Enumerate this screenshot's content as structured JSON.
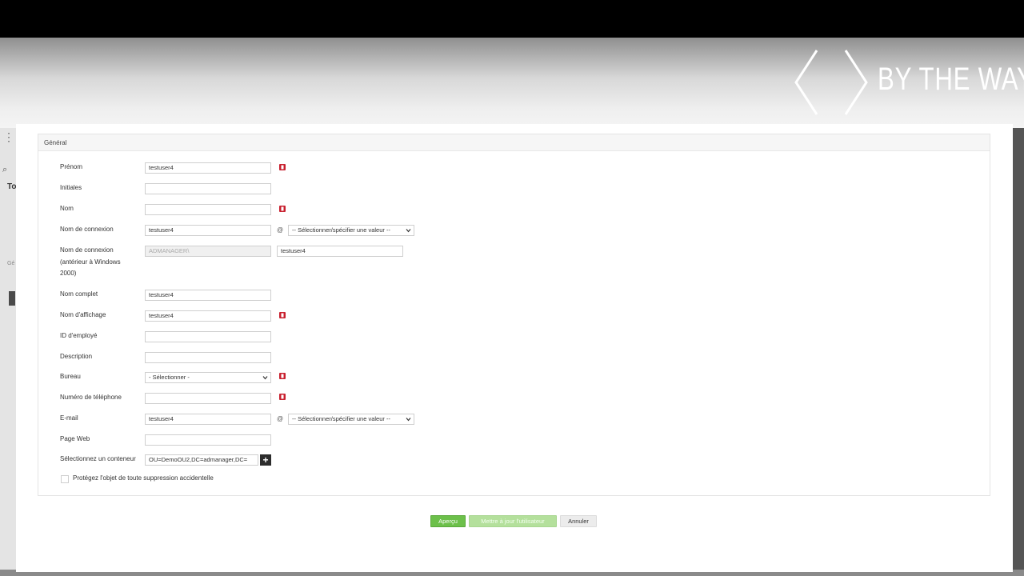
{
  "brand": {
    "text": "BY THE WAY"
  },
  "background_app": {
    "search_glyph": "⌕",
    "to_text": "To",
    "ge_text": "Gé"
  },
  "form": {
    "section_title": "Général",
    "fields": {
      "prenom": {
        "label": "Prénom",
        "value": "testuser4"
      },
      "initiales": {
        "label": "Initiales",
        "value": ""
      },
      "nom": {
        "label": "Nom",
        "value": ""
      },
      "nom_connexion": {
        "label": "Nom de connexion",
        "value": "testuser4",
        "at": "@",
        "domain_select": "-- Sélectionner/spécifier une valeur --"
      },
      "nom_connexion_pre2000": {
        "label_line1": "Nom de connexion",
        "label_line2": "(antérieur à Windows",
        "label_line3": "2000)",
        "prefix": "ADMANAGER\\",
        "value": "testuser4"
      },
      "nom_complet": {
        "label": "Nom complet",
        "value": "testuser4"
      },
      "nom_affichage": {
        "label": "Nom d'affichage",
        "value": "testuser4"
      },
      "id_employe": {
        "label": "ID d'employé",
        "value": ""
      },
      "description": {
        "label": "Description",
        "value": ""
      },
      "bureau": {
        "label": "Bureau",
        "select_value": "- Sélectionner -"
      },
      "telephone": {
        "label": "Numéro de téléphone",
        "value": ""
      },
      "email": {
        "label": "E-mail",
        "value": "testuser4",
        "at": "@",
        "domain_select": "-- Sélectionner/spécifier une valeur --"
      },
      "page_web": {
        "label": "Page Web",
        "value": ""
      },
      "conteneur": {
        "label": "Sélectionnez un conteneur",
        "value": "OU=DemoOU2,DC=admanager,DC="
      },
      "protect": {
        "label": "Protégez l'objet de toute suppression accidentelle",
        "checked": false
      }
    }
  },
  "buttons": {
    "preview": "Aperçu",
    "update": "Mettre à jour l'utilisateur",
    "cancel": "Annuler"
  },
  "colors": {
    "office_icon": "#c8202f",
    "primary_button": "#6cc04a",
    "disabled_button": "#b4e09c"
  }
}
